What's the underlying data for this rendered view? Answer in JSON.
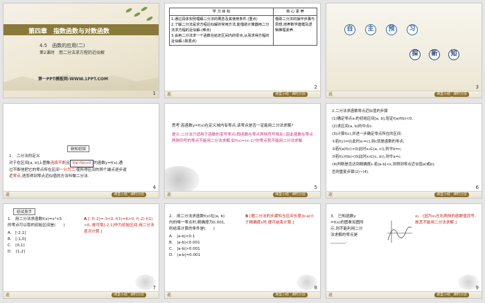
{
  "slides": {
    "s1": {
      "chapter": "第四章　指数函数与对数函数",
      "section": "4.5　函数的应用(二)",
      "lesson": "第2课时　用二分法求方程的近似解",
      "brand": "第一PPT模板网-WWW.1PPT.COM",
      "num": "1"
    },
    "s2": {
      "col1": "学 习 目 标",
      "col2": "核 心 素 养",
      "g1": "1.通过具体实例理解二分法的概念及其使用条件.(重点)",
      "g2": "2.了解二分法是求方程近似解的常用方法,能借助计算器用二分法求方程的近似解.(难点)",
      "g3": "3.会用二分法求一个函数在给定区间内的零点,从而求得方程的近似解.(易混点)",
      "core": "借助二分法的操作步骤与思想,培养数学建模及逻辑推理素养.",
      "num": "2"
    },
    "s3": {
      "a1": "自",
      "a2": "主",
      "a3": "预",
      "a4": "习",
      "b1": "探",
      "b2": "新",
      "b3": "知",
      "num": "3"
    },
    "s4": {
      "header": "新知初探",
      "line1": "1.　二分法的定义",
      "line2a": "对于在区间[a, b]上图象",
      "line2b": "连续不断",
      "line2c": "且",
      "line2d": "f(a)·f(b)<0",
      "line2e": "的函数y=f(x),通",
      "line3a": "过不断地把它的零点所在区间",
      "line3b": "一分为二",
      "line3c": ",使所得区间的两个端点逐步逼",
      "line4a": "近",
      "line4b": "零点",
      "line4c": ",进而得到零点近似值的方法叫做二分法.",
      "num": "4"
    },
    "s5": {
      "q": "思考:若函数y=f(x)在定义域内有零点,该零点是否一定能用二分法求解?",
      "tip_label": "提示:",
      "tip": "二分法只适用于函数的变号零点(即函数在零点两侧符号相反),因此函数在零点两侧同号的零点不能用二分法求解,如f(x)=(x-1)²的零点就不能用二分法求解.",
      "num": "5"
    },
    "s6": {
      "l1": "2.二分法求函数零点近似值的步骤",
      "l2": "(1)确定零点x₀的初始区间[a, b],验证f(a)f(b)<0.",
      "l3": "(2)求区间(a, b)的中点c.",
      "l4": "(3)计算f(c),并进一步确定零点所在的区间:",
      "l5": "①若f(c)=0(此时x₀=c),则c就是函数的零点;",
      "l6": "②若f(a)f(c)<0(此时x₀∈(a, c)),则令b=c;",
      "l7": "③若f(c)f(b)<0(此时x₀∈(c, b)),则令a=c.",
      "l8": "(4)判断是否达到精确度ε:若|a-b|<ε,则得到零点近似值a(或b);",
      "l9": "否则重复步骤(2)~(4).",
      "num": "6"
    },
    "s7": {
      "header": "初试身手",
      "q1": "1.　用二分法求函数f(x)=x³+5",
      "q2": "的零点可以取的初始区间是(　　)",
      "oA": "A.　[-2,1]",
      "oB": "B.　[-1,0]",
      "oC": "C.　[0,1]",
      "oD": "D.　[1,2]",
      "ansLetter": "A",
      "ans": "[∵f(-2)=-3<0, f(1)=6>0, f(-2)·f(1)<0, 故可取[-2,1]作为初始区间,用二分法逐次计算.]",
      "num": "7"
    },
    "s8": {
      "q1": "2.　用二分法求函数f(x)在(a, b)",
      "q2": "内的唯一零点时,精确度为0.001,",
      "q3": "则结束计算的条件是(　　)",
      "oA": "A.　|a-b|<0.1",
      "oB": "B.　|a-b|<0.001",
      "oC": "C.　|a-b|>0.001",
      "oD": "D.　|a-b|=0.001",
      "ansLetter": "B",
      "ans": "[据二分法的步骤知当区间长度|b-a|小于精确度ε时,便可结束计算.]",
      "num": "8"
    },
    "s9": {
      "q1": "3.　已知函数y",
      "q2": "=f(x)的图象如图所",
      "q3": "示,则不能利用二分",
      "q4": "法求解的零点是",
      "q5": "________.",
      "ans": "x₃　[因为x₃左右两侧的函数值同号,故其不能用二分法求解.]",
      "num": "9"
    }
  },
  "footer": {
    "left": "返",
    "btn1": "课堂小结",
    "btn2": "课时分层"
  }
}
